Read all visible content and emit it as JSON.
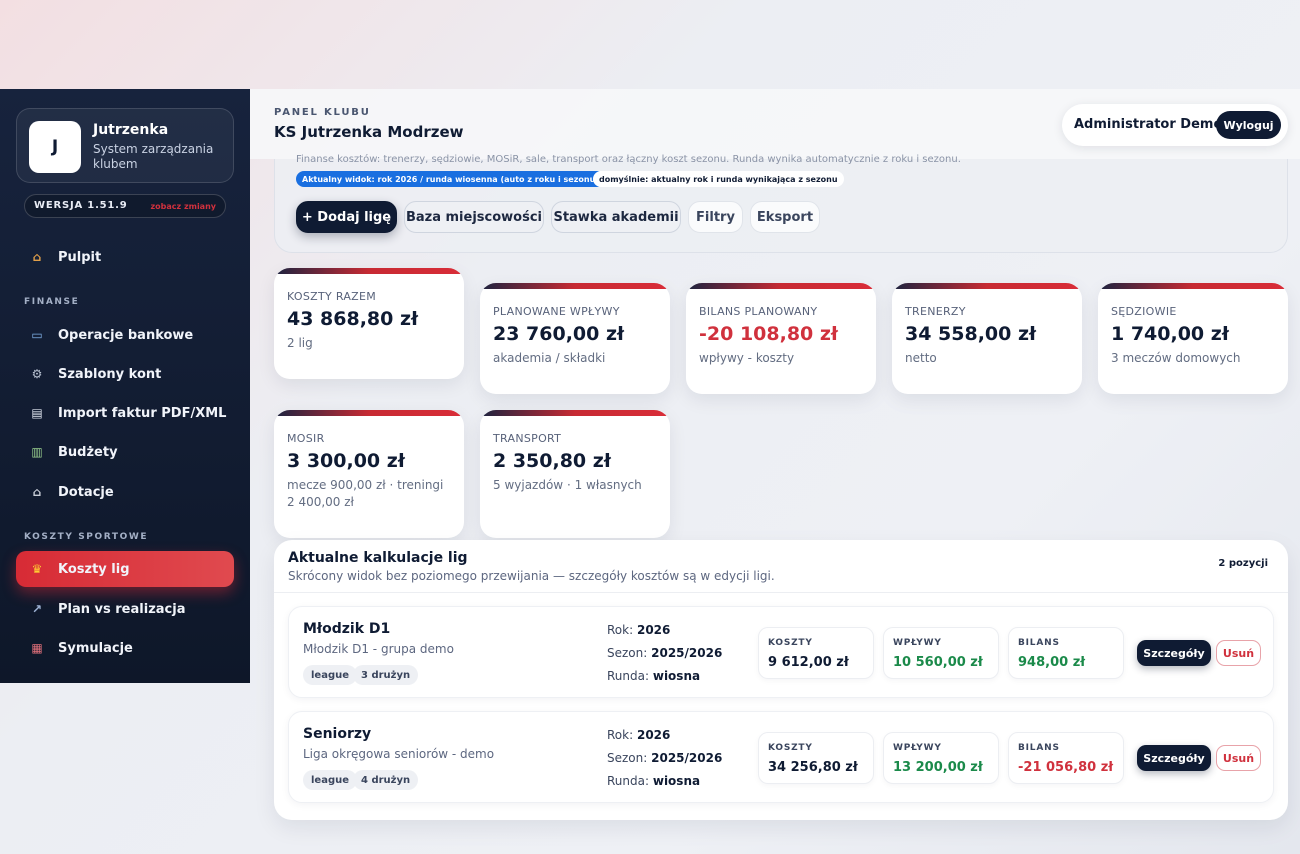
{
  "brand": {
    "logo_letter": "J",
    "name": "Jutrzenka",
    "subtitle": "System zarządzania klubem",
    "version": "WERSJA 1.51.9",
    "changes_link": "zobacz zmiany"
  },
  "sidebar": {
    "items": [
      {
        "label": "Pulpit",
        "icon": "home-icon"
      },
      {
        "label": "Operacje bankowe",
        "icon": "bank-card-icon"
      },
      {
        "label": "Szablony kont",
        "icon": "gear-icon"
      },
      {
        "label": "Import faktur PDF/XML",
        "icon": "document-icon"
      },
      {
        "label": "Budżety",
        "icon": "bar-chart-icon"
      },
      {
        "label": "Dotacje",
        "icon": "institution-icon"
      },
      {
        "label": "Koszty lig",
        "icon": "trophy-icon"
      },
      {
        "label": "Plan vs realizacja",
        "icon": "line-chart-icon"
      },
      {
        "label": "Symulacje",
        "icon": "calculator-icon"
      }
    ],
    "sections": [
      "FINANSE",
      "KOSZTY SPORTOWE"
    ],
    "active": "Koszty lig"
  },
  "header": {
    "kicker": "PANEL KLUBU",
    "title": "KS Jutrzenka Modrzew",
    "user": "Administrator Demo",
    "logout": "Wyloguj"
  },
  "toolbar": {
    "description": "Finanse kosztów: trenerzy, sędziowie, MOSiR, sale, transport oraz łączny koszt sezonu. Runda wynika automatycznie z roku i sezonu.",
    "chip_current": "Aktualny widok: rok 2026 / runda wiosenna (auto z roku i sezonu)",
    "chip_default": "domyślnie: aktualny rok i runda wynikająca z sezonu",
    "add_league": "+ Dodaj ligę",
    "venues": "Baza miejscowości",
    "academy_rate": "Stawka akademii",
    "filters": "Filtry",
    "export": "Eksport"
  },
  "kpis": [
    {
      "label": "KOSZTY RAZEM",
      "value": "43 868,80 zł",
      "sub": "2 lig"
    },
    {
      "label": "PLANOWANE WPŁYWY",
      "value": "23 760,00 zł",
      "sub": "akademia / składki"
    },
    {
      "label": "BILANS PLANOWANY",
      "value": "-20 108,80 zł",
      "sub": "wpływy - koszty"
    },
    {
      "label": "TRENERZY",
      "value": "34 558,00 zł",
      "sub": "netto"
    },
    {
      "label": "SĘDZIOWIE",
      "value": "1 740,00 zł",
      "sub": "3 meczów domowych"
    },
    {
      "label": "MOSIR",
      "value": "3 300,00 zł",
      "sub": "mecze 900,00 zł · treningi 2 400,00 zł"
    },
    {
      "label": "TRANSPORT",
      "value": "2 350,80 zł",
      "sub": "5 wyjazdów · 1 własnych"
    }
  ],
  "leagues": {
    "title": "Aktualne kalkulacje lig",
    "subtitle": "Skrócony widok bez poziomego przewijania — szczegóły kosztów są w edycji ligi.",
    "count": "2 pozycji",
    "labels": {
      "year": "Rok:",
      "season": "Sezon:",
      "round": "Runda:",
      "costs": "KOSZTY",
      "income": "WPŁYWY",
      "balance": "BILANS",
      "details": "Szczegóły",
      "remove": "Usuń"
    },
    "rows": [
      {
        "name": "Młodzik D1",
        "desc": "Młodzik D1 - grupa demo",
        "tag_type": "league",
        "tag_teams": "3 drużyn",
        "year": "2026",
        "season": "2025/2026",
        "round": "wiosna",
        "costs": "9 612,00 zł",
        "income": "10 560,00 zł",
        "balance": "948,00 zł"
      },
      {
        "name": "Seniorzy",
        "desc": "Liga okręgowa seniorów - demo",
        "tag_type": "league",
        "tag_teams": "4 drużyn",
        "year": "2026",
        "season": "2025/2026",
        "round": "wiosna",
        "costs": "34 256,80 zł",
        "income": "13 200,00 zł",
        "balance": "-21 056,80 zł"
      }
    ]
  },
  "colors": {
    "navy": "#0f1b33",
    "accent_red": "#d72b35",
    "positive": "#1b8a4a",
    "negative": "#d0313d",
    "chip_blue": "#1a6fe0"
  }
}
